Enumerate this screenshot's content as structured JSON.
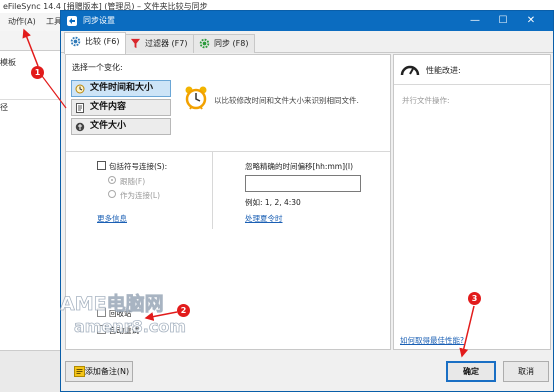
{
  "background_app": {
    "title": "eFileSync 14.4 [捐赠版本] (管理员) – 文件夹比较与同步",
    "menu_action": "动作(A)",
    "menu_tools": "工具",
    "panel_header": "模板",
    "panel_column": "径"
  },
  "dialog": {
    "title": "同步设置",
    "minimize": "—",
    "maximize": "☐",
    "close": "✕"
  },
  "tabs": [
    {
      "label": "比较 (F6)",
      "icon": "gear-icon"
    },
    {
      "label": "过滤器 (F7)",
      "icon": "filter-icon"
    },
    {
      "label": "同步 (F8)",
      "icon": "sync-gear-icon"
    }
  ],
  "compare": {
    "choose_label": "选择一个变化:",
    "options": [
      {
        "label": "文件时间和大小",
        "selected": true,
        "icon": "clock-icon"
      },
      {
        "label": "文件内容",
        "selected": false,
        "icon": "document-icon"
      },
      {
        "label": "文件大小",
        "selected": false,
        "icon": "scale-icon"
      }
    ],
    "description": "以比较修改时间和文件大小来识别相同文件."
  },
  "symlink": {
    "checkbox_label": "包括符号连接(S):",
    "checked": false,
    "radio_follow": "跟随(F)",
    "radio_as_link": "作为连接(L)",
    "more_info": "更多信息"
  },
  "time_offset": {
    "label": "忽略精确的时间偏移[hh:mm](I)",
    "value": "",
    "example": "例如: 1, 2, 4:30",
    "dst_link": "处理夏令时"
  },
  "extra_options": {
    "recycle_label": "回收站",
    "auto_retry_label": "自动重试"
  },
  "performance": {
    "title": "性能改进:",
    "parallel_label": "并行文件操作:",
    "link": "如何取得最佳性能?"
  },
  "buttons": {
    "add_note": "添加备注(N)",
    "ok": "确定",
    "cancel": "取消"
  },
  "annotations": {
    "marker1": "1",
    "marker2": "2",
    "marker3": "3",
    "accent": "#e21b1b"
  },
  "watermark": {
    "line1": "AME电脑网",
    "line2": "amenr8.com"
  },
  "colors": {
    "title_bar": "#0b6cc0",
    "selection": "#cde4f7",
    "link": "#1a5fb4"
  }
}
